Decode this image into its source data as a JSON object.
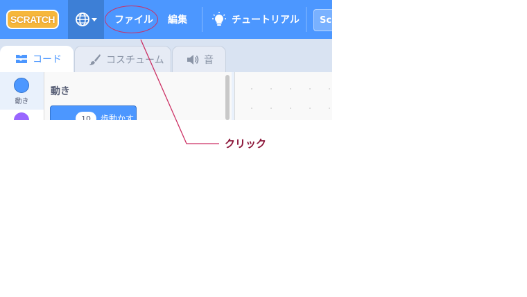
{
  "menubar": {
    "logo_text": "SCRATCH",
    "file_label": "ファイル",
    "edit_label": "編集",
    "tutorial_label": "チュートリアル",
    "project_title_partial": "Sc"
  },
  "tabs": [
    {
      "label": "コード"
    },
    {
      "label": "コスチューム"
    },
    {
      "label": "音"
    }
  ],
  "categories": {
    "motion_label": "動き"
  },
  "palette": {
    "section_title": "動き",
    "block_input": "10",
    "block_text": "歩動かす"
  },
  "annotation": {
    "label": "クリック"
  },
  "colors": {
    "menubar": "#4c97ff",
    "motion": "#4c97ff",
    "looks": "#9966ff",
    "callout": "#cc2f63"
  }
}
